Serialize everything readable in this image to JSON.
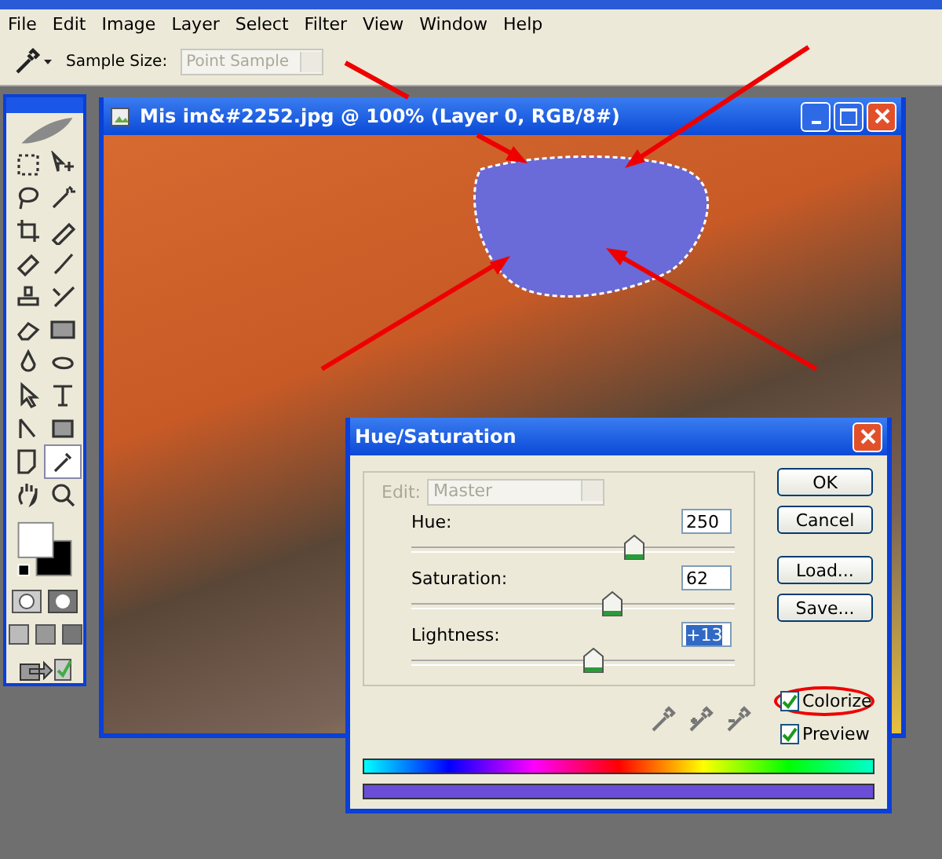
{
  "menu": [
    "File",
    "Edit",
    "Image",
    "Layer",
    "Select",
    "Filter",
    "View",
    "Window",
    "Help"
  ],
  "options_bar": {
    "label": "Sample Size:",
    "select": "Point Sample"
  },
  "document": {
    "title": "Mis im&#2252.jpg @ 100% (Layer 0, RGB/8#)"
  },
  "dialog": {
    "title": "Hue/Saturation",
    "edit_label": "Edit:",
    "edit_value": "Master",
    "edit_disabled": true,
    "sliders": [
      {
        "label": "Hue:",
        "value": "250",
        "level": 0.69,
        "selected": false
      },
      {
        "label": "Saturation:",
        "value": "62",
        "level": 0.62,
        "selected": false
      },
      {
        "label": "Lightness:",
        "value": "+13",
        "level": 0.565,
        "selected": true
      }
    ],
    "buttons": [
      "OK",
      "Cancel",
      "Load...",
      "Save..."
    ],
    "checkboxes": [
      {
        "label": "Colorize",
        "checked": true,
        "circled": true
      },
      {
        "label": "Preview",
        "checked": true,
        "circled": false
      }
    ]
  }
}
